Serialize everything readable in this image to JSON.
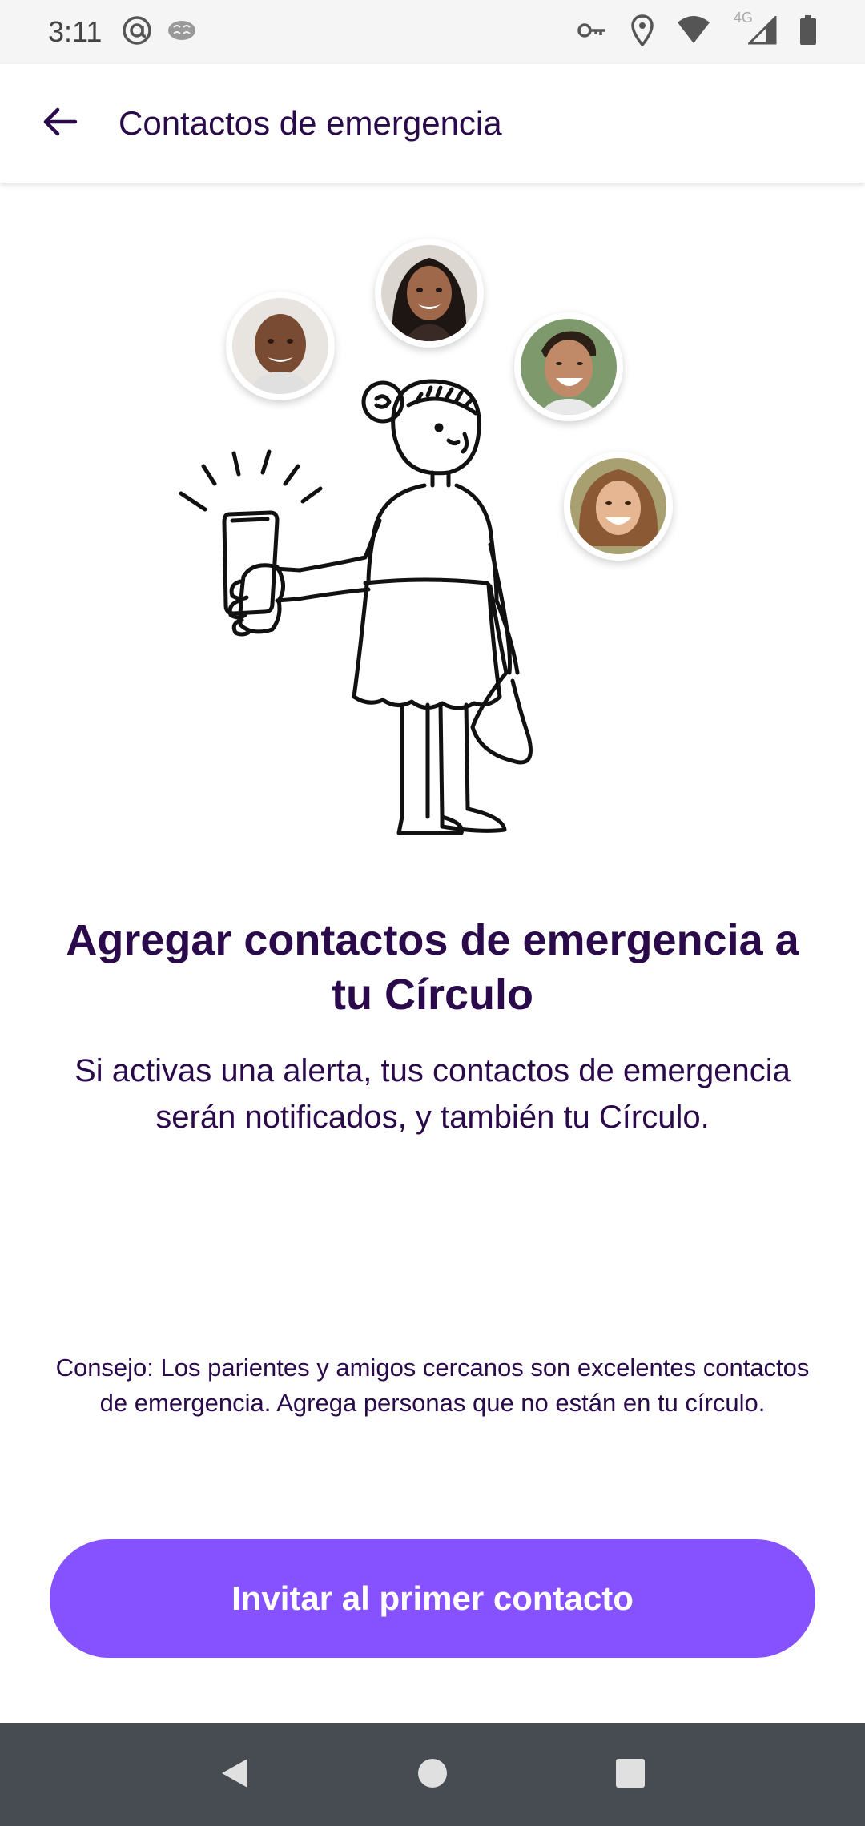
{
  "status_bar": {
    "time": "3:11",
    "network": "4G",
    "icons": [
      "at-sign-icon",
      "brain-icon",
      "key-icon",
      "location-icon",
      "wifi-icon",
      "signal-icon",
      "battery-icon"
    ]
  },
  "app_bar": {
    "back_icon": "arrow-left-icon",
    "title": "Contactos de emergencia"
  },
  "hero": {
    "illustration": "woman-holding-phone-illustration",
    "avatars": [
      "avatar-man-1",
      "avatar-woman-1",
      "avatar-man-2",
      "avatar-woman-2"
    ]
  },
  "content": {
    "headline": "Agregar contactos de emergencia a tu Círculo",
    "description": "Si activas una alerta, tus contactos de emergencia serán notificados, y también tu Círculo.",
    "tip": "Consejo: Los parientes y amigos cercanos son excelentes contactos de emergencia. Agrega personas que no están en tu círculo."
  },
  "actions": {
    "primary_label": "Invitar al primer contacto"
  },
  "colors": {
    "accent": "#8652ff",
    "text": "#2a0a4a",
    "nav_bar": "#474c52"
  },
  "system_nav": {
    "icons": [
      "back-triangle-icon",
      "home-circle-icon",
      "recents-square-icon"
    ]
  }
}
